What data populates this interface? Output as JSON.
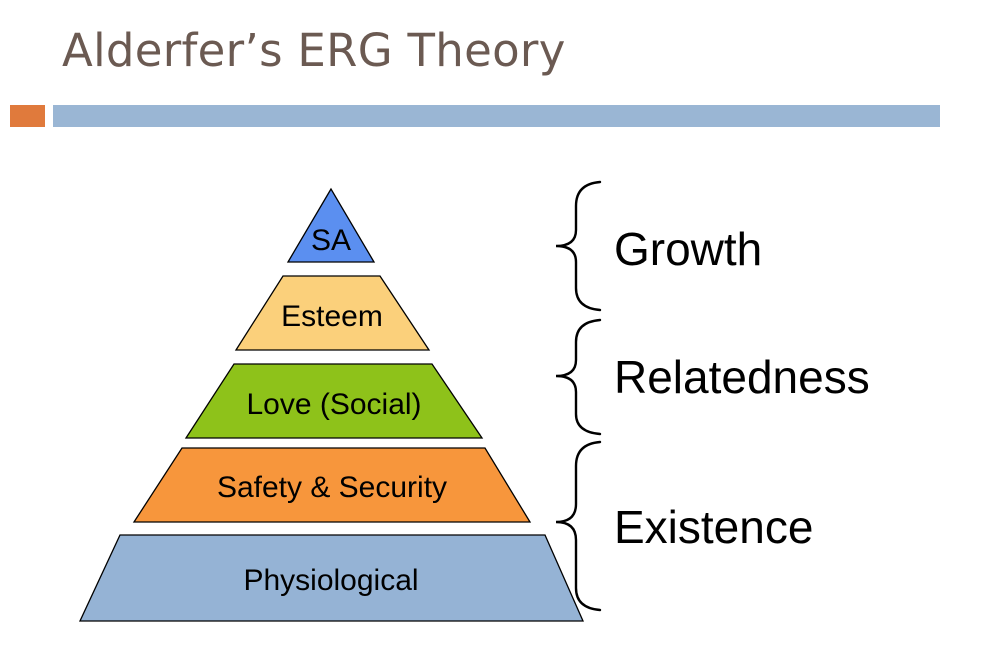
{
  "title": "Alderfer’s ERG Theory",
  "pyramid": {
    "levels": [
      {
        "label": "SA",
        "color": "#5b8ff0"
      },
      {
        "label": "Esteem",
        "color": "#fbd07b"
      },
      {
        "label": "Love (Social)",
        "color": "#8ec21a"
      },
      {
        "label": "Safety & Security",
        "color": "#f7963c"
      },
      {
        "label": "Physiological",
        "color": "#95b3d5"
      }
    ]
  },
  "groups": [
    {
      "label": "Growth"
    },
    {
      "label": "Relatedness"
    },
    {
      "label": "Existence"
    }
  ],
  "colors": {
    "title": "#6b5a52",
    "accent": "#e07a3c",
    "rule": "#9ab6d4",
    "outline": "#000000"
  }
}
